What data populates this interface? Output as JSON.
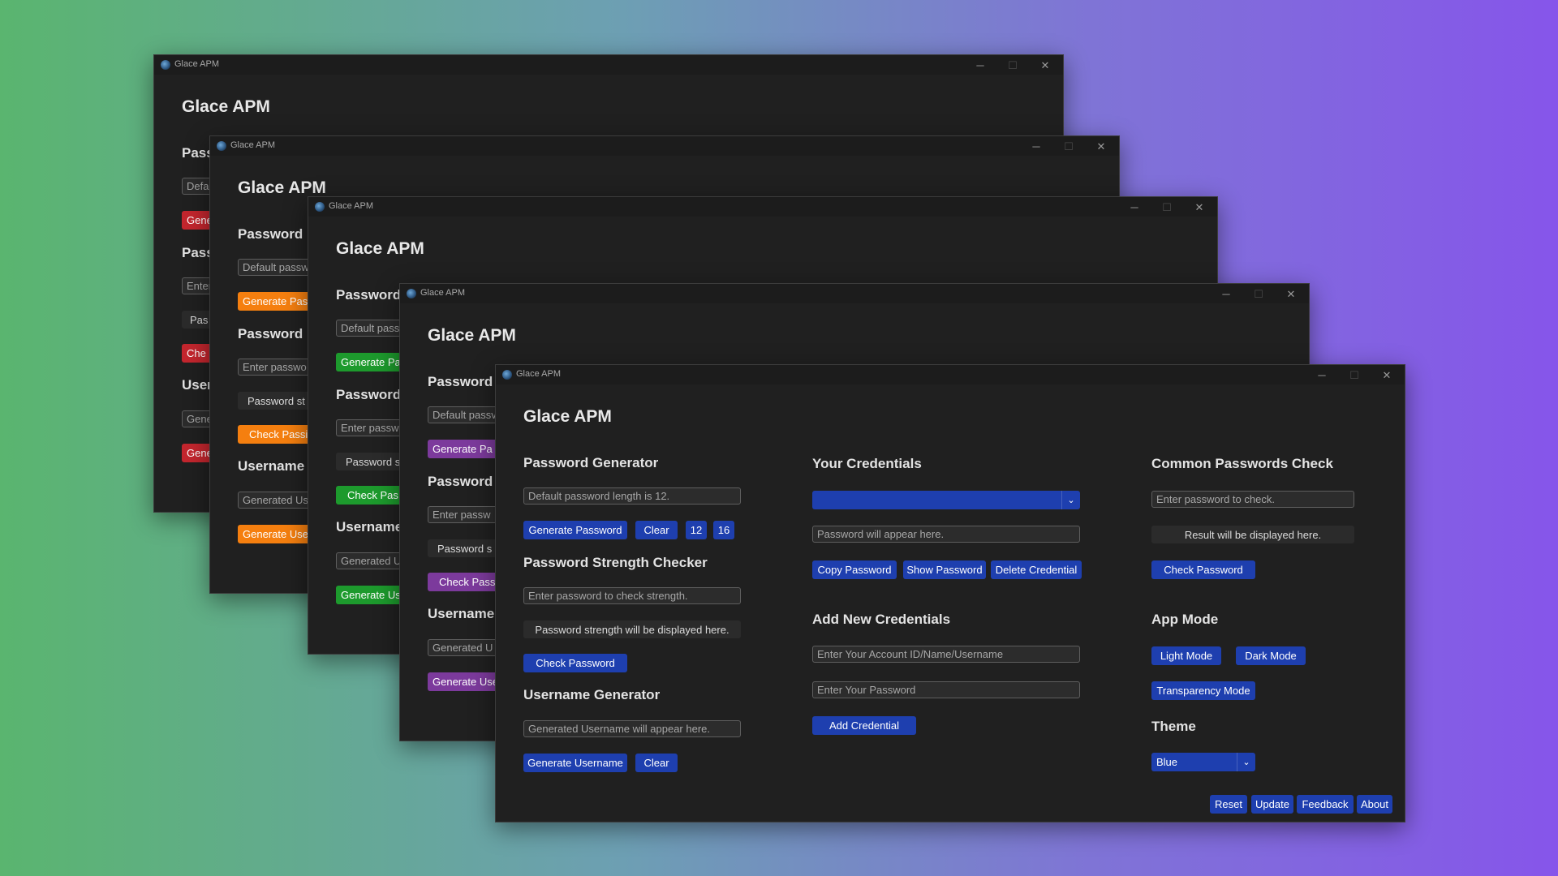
{
  "windows": [
    {
      "title": "Glace APM",
      "app_title": "Glace APM",
      "accent": "#c4262e",
      "sections": [
        "Pass",
        "Pass",
        "User"
      ],
      "fields": [
        "Defa",
        "Enter",
        "Gene"
      ],
      "buttons": [
        "Gene",
        "Che",
        "Gene"
      ],
      "status": "Pas"
    },
    {
      "title": "Glace APM",
      "app_title": "Glace APM",
      "accent": "#f57f0f",
      "sections": [
        "Password",
        "Password",
        "Username"
      ],
      "fields": [
        "Default passw",
        "Enter passwo",
        "Generated Us"
      ],
      "buttons": [
        "Generate Pas",
        "Check Passi",
        "Generate Use"
      ],
      "status": "Password st"
    },
    {
      "title": "Glace APM",
      "app_title": "Glace APM",
      "accent": "#1d9a2d",
      "sections": [
        "Password",
        "Password",
        "Username"
      ],
      "fields": [
        "Default pass",
        "Enter passw",
        "Generated U"
      ],
      "buttons": [
        "Generate Pa",
        "Check Pas",
        "Generate Us"
      ],
      "status": "Password s"
    },
    {
      "title": "Glace APM",
      "app_title": "Glace APM",
      "accent": "#7c3a9c",
      "sections": [
        "Password",
        "Password",
        "Username"
      ],
      "fields": [
        "Default passv",
        "Enter passw",
        "Generated U"
      ],
      "buttons": [
        "Generate Pa",
        "Check Pass",
        "Generate Use"
      ],
      "status": "Password s"
    }
  ],
  "main": {
    "title": "Glace APM",
    "app_title": "Glace APM",
    "accent": "#1e3faf",
    "password_generator": {
      "heading": "Password Generator",
      "placeholder": "Default password length is 12.",
      "generate": "Generate Password",
      "clear": "Clear",
      "len_12": "12",
      "len_16": "16"
    },
    "strength_checker": {
      "heading": "Password Strength Checker",
      "placeholder": "Enter password to check strength.",
      "result": "Password strength will be displayed here.",
      "check": "Check Password"
    },
    "username_generator": {
      "heading": "Username Generator",
      "placeholder": "Generated Username will appear here.",
      "generate": "Generate Username",
      "clear": "Clear"
    },
    "your_credentials": {
      "heading": "Your Credentials",
      "selected": "",
      "password_placeholder": "Password will appear here.",
      "copy": "Copy Password",
      "show": "Show Password",
      "delete": "Delete Credential"
    },
    "add_credentials": {
      "heading": "Add New Credentials",
      "account_placeholder": "Enter Your Account ID/Name/Username",
      "password_placeholder": "Enter Your Password",
      "add": "Add Credential"
    },
    "common_check": {
      "heading": "Common Passwords Check",
      "placeholder": "Enter password to check.",
      "result": "Result will be displayed here.",
      "check": "Check Password"
    },
    "app_mode": {
      "heading": "App Mode",
      "light": "Light Mode",
      "dark": "Dark Mode",
      "transparency": "Transparency Mode"
    },
    "theme": {
      "heading": "Theme",
      "selected": "Blue"
    },
    "footer": {
      "reset": "Reset",
      "update": "Update",
      "feedback": "Feedback",
      "about": "About"
    }
  },
  "icons": {
    "minimize": "minimize-icon",
    "maximize": "maximize-icon",
    "close": "close-icon",
    "chevron": "chevron-down-icon",
    "logo": "app-logo-icon"
  }
}
